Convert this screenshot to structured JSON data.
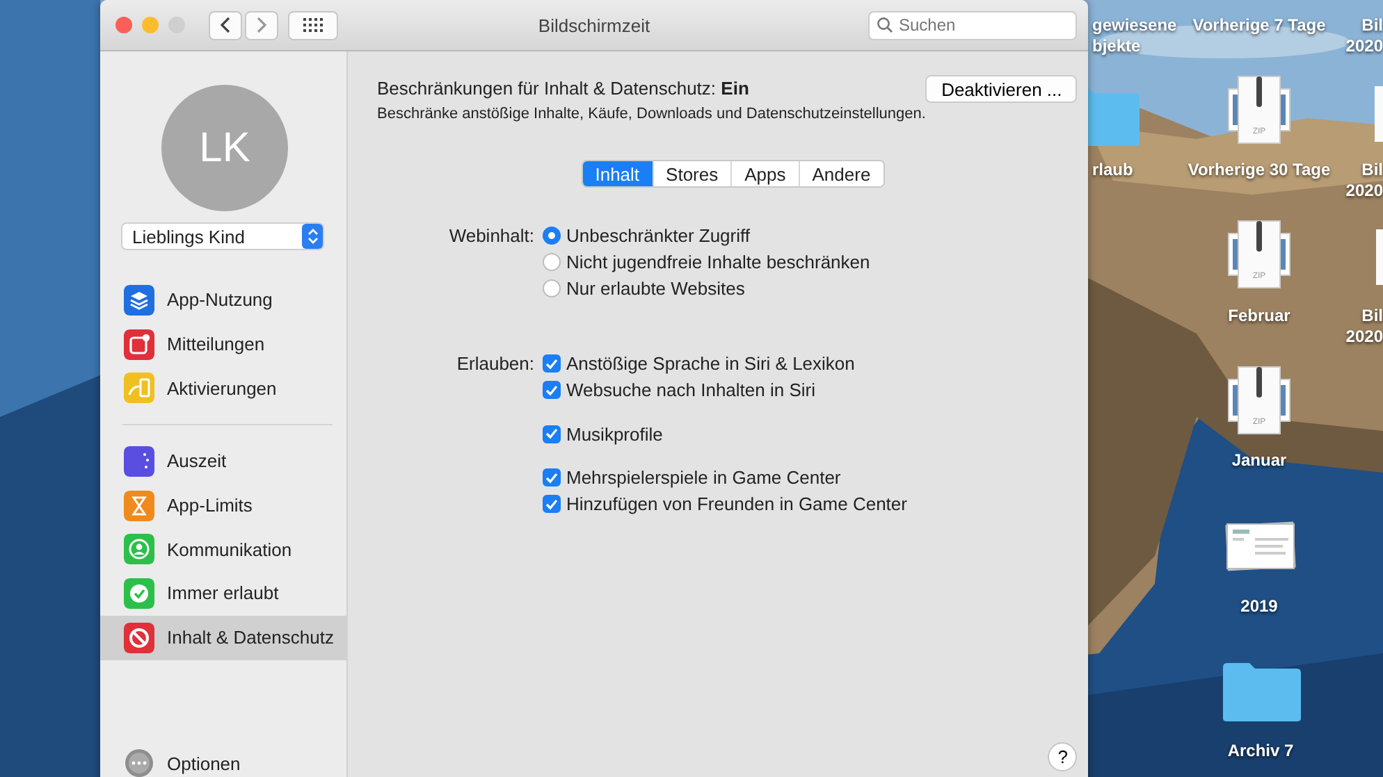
{
  "window": {
    "title": "Bildschirmzeit",
    "search": {
      "placeholder": "Suchen"
    }
  },
  "sidebar": {
    "avatar_initials": "LK",
    "user_select": "Lieblings Kind",
    "groups": [
      {
        "items": [
          {
            "label": "App-Nutzung",
            "selected": false
          },
          {
            "label": "Mitteilungen",
            "selected": false
          },
          {
            "label": "Aktivierungen",
            "selected": false
          }
        ]
      },
      {
        "items": [
          {
            "label": "Auszeit",
            "selected": false
          },
          {
            "label": "App-Limits",
            "selected": false
          },
          {
            "label": "Kommunikation",
            "selected": false
          },
          {
            "label": "Immer erlaubt",
            "selected": false
          },
          {
            "label": "Inhalt & Datenschutz",
            "selected": true
          }
        ]
      }
    ],
    "options": "Optionen"
  },
  "content": {
    "heading": "Beschränkungen für Inhalt & Datenschutz: **Ein**",
    "description": "Beschränke anstößige Inhalte, Käufe, Downloads und Datenschutzeinstellungen.",
    "deactivate_button": "Deaktivieren ...",
    "tabs": [
      {
        "label": "Inhalt",
        "selected": true
      },
      {
        "label": "Stores",
        "selected": false
      },
      {
        "label": "Apps",
        "selected": false
      },
      {
        "label": "Andere",
        "selected": false
      }
    ],
    "web_content": {
      "label": "Webinhalt:",
      "options": [
        {
          "label": "Unbeschränkter Zugriff",
          "selected": true
        },
        {
          "label": "Nicht jugendfreie Inhalte beschränken",
          "selected": false
        },
        {
          "label": "Nur erlaubte Websites",
          "selected": false
        }
      ]
    },
    "allow": {
      "label": "Erlauben:",
      "groups": [
        {
          "items": [
            {
              "label": "Anstößige Sprache in Siri & Lexikon",
              "checked": true
            },
            {
              "label": "Websuche nach Inhalten in Siri",
              "checked": true
            }
          ]
        },
        {
          "items": [
            {
              "label": "Musikprofile",
              "checked": true
            }
          ]
        },
        {
          "items": [
            {
              "label": "Mehrspielerspiele in Game Center",
              "checked": true
            },
            {
              "label": "Hinzufügen von Freunden in Game Center",
              "checked": true
            }
          ]
        }
      ]
    },
    "help_button": "?"
  },
  "desktop": {
    "items": [
      {
        "kind": "label",
        "lines": [
          "gewiesene",
          "bjekte"
        ]
      },
      {
        "kind": "label",
        "lines": [
          "Vorherige 7 Tage"
        ]
      },
      {
        "kind": "label",
        "lines": [
          "Bil",
          "2020"
        ]
      },
      {
        "kind": "folder",
        "lines": [
          "rlaub"
        ]
      },
      {
        "kind": "archive",
        "badge": "ZIP",
        "lines": [
          "Vorherige 30 Tage"
        ]
      },
      {
        "kind": "file",
        "lines": [
          "Bil",
          "2020"
        ]
      },
      {
        "kind": "archive",
        "badge": "ZIP",
        "lines": [
          "Februar"
        ]
      },
      {
        "kind": "file",
        "lines": [
          "Bil",
          "2020"
        ]
      },
      {
        "kind": "archive",
        "badge": "ZIP",
        "lines": [
          "Januar"
        ]
      },
      {
        "kind": "documents",
        "lines": [
          "2019"
        ]
      },
      {
        "kind": "folder",
        "lines": [
          "Archiv 7"
        ]
      }
    ]
  }
}
